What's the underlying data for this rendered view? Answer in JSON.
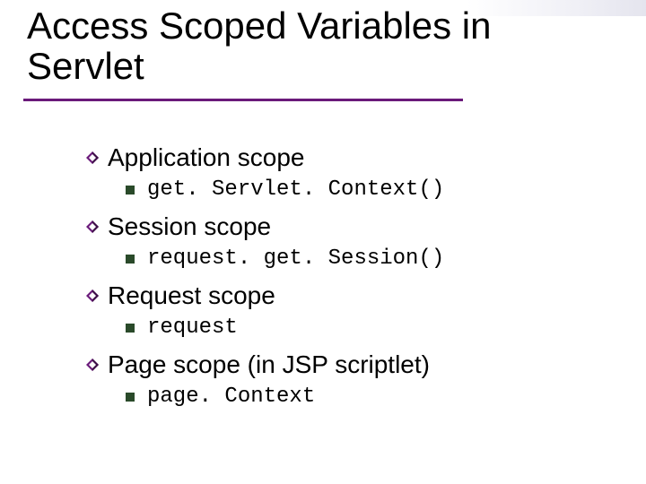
{
  "title": {
    "line1": "Access Scoped Variables in",
    "line2": "Servlet"
  },
  "scopes": [
    {
      "label": "Application scope",
      "code": "get. Servlet. Context()"
    },
    {
      "label": "Session scope",
      "code": "request. get. Session()"
    },
    {
      "label": "Request scope",
      "code": "request"
    },
    {
      "label": "Page scope (in JSP scriptlet)",
      "code": "page. Context"
    }
  ],
  "icons": {
    "diamond": "diamond-icon",
    "square": "square-icon"
  }
}
